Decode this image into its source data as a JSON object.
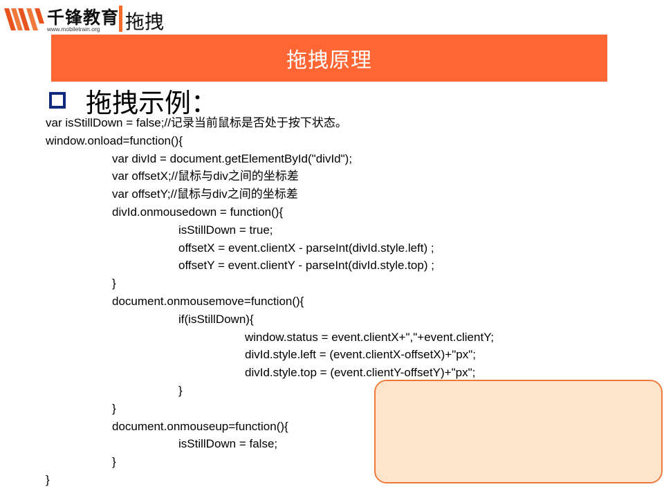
{
  "header": {
    "brand_name": "千锋教育",
    "brand_url": "www.mobiletrain.org",
    "title": "拖拽"
  },
  "banner": {
    "title": "拖拽原理"
  },
  "section": {
    "title": "拖拽示例："
  },
  "code": [
    {
      "indent": 0,
      "text": "var isStillDown = false;//记录当前鼠标是否处于按下状态。"
    },
    {
      "indent": 0,
      "text": "window.onload=function(){"
    },
    {
      "indent": 1,
      "text": "var divId = document.getElementById(\"divId\");"
    },
    {
      "indent": 1,
      "text": "var offsetX;//鼠标与div之间的坐标差"
    },
    {
      "indent": 1,
      "text": "var offsetY;//鼠标与div之间的坐标差"
    },
    {
      "indent": 1,
      "text": "divId.onmousedown = function(){"
    },
    {
      "indent": 2,
      "text": "isStillDown = true;"
    },
    {
      "indent": 2,
      "text": "offsetX = event.clientX - parseInt(divId.style.left) ;"
    },
    {
      "indent": 2,
      "text": "offsetY = event.clientY - parseInt(divId.style.top) ;"
    },
    {
      "indent": 1,
      "text": "}"
    },
    {
      "indent": 1,
      "text": "document.onmousemove=function(){"
    },
    {
      "indent": 2,
      "text": "if(isStillDown){"
    },
    {
      "indent": 3,
      "text": "window.status = event.clientX+\",\"+event.clientY;"
    },
    {
      "indent": 3,
      "text": "divId.style.left = (event.clientX-offsetX)+\"px\";"
    },
    {
      "indent": 3,
      "text": "divId.style.top = (event.clientY-offsetY)+\"px\";"
    },
    {
      "indent": 2,
      "text": "}"
    },
    {
      "indent": 1,
      "text": "}"
    },
    {
      "indent": 1,
      "text": "document.onmouseup=function(){"
    },
    {
      "indent": 2,
      "text": "isStillDown = false;"
    },
    {
      "indent": 1,
      "text": "}"
    },
    {
      "indent": 0,
      "text": "}"
    }
  ],
  "colors": {
    "accent": "#FF6633",
    "header_bar": "#F26B2A",
    "bullet": "#102A7E",
    "callout_fill": "#FDE5CC",
    "callout_border": "#F07A3C"
  },
  "icons": {
    "logo": "mobiletrain-logo-icon",
    "bullet": "square-bullet-icon"
  }
}
